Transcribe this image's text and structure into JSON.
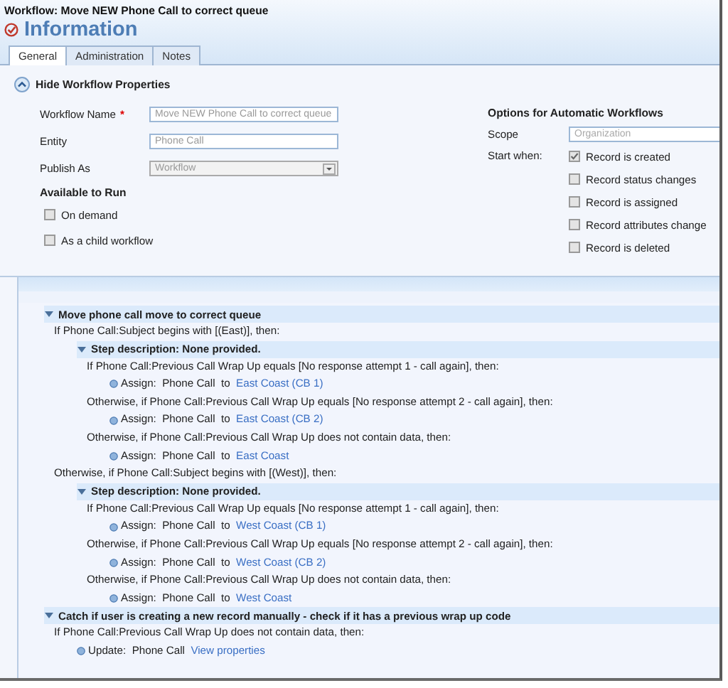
{
  "header": {
    "title": "Workflow: Move NEW Phone Call to correct queue",
    "heading": "Information"
  },
  "tabs": [
    {
      "label": "General",
      "selected": true
    },
    {
      "label": "Administration",
      "selected": false
    },
    {
      "label": "Notes",
      "selected": false
    }
  ],
  "properties": {
    "toggle": "Hide Workflow Properties",
    "expanded": true,
    "fields": [
      {
        "label": "Workflow Name",
        "required": "*",
        "value": "Move NEW Phone Call to correct queue",
        "kind": "text"
      },
      {
        "label": "Entity",
        "value": "Phone Call",
        "kind": "text"
      },
      {
        "label": "Publish As",
        "value": "Workflow",
        "kind": "select"
      }
    ],
    "available": {
      "heading": "Available to Run",
      "options": [
        {
          "label": "On demand",
          "checked": false
        },
        {
          "label": "As a child workflow",
          "checked": false
        }
      ]
    },
    "automatic": {
      "heading": "Options for Automatic Workflows",
      "scope_label": "Scope",
      "scope_value": "Organization",
      "start_label": "Start when:",
      "options": [
        {
          "label": "Record is created",
          "checked": true
        },
        {
          "label": "Record status changes",
          "checked": false
        },
        {
          "label": "Record is assigned",
          "checked": false
        },
        {
          "label": "Record attributes change",
          "checked": false
        },
        {
          "label": "Record is deleted",
          "checked": false
        }
      ]
    }
  },
  "steps": [
    {
      "kind": "stage",
      "label": "Move phone call move to correct queue",
      "expanded": true,
      "children": [
        {
          "kind": "condition",
          "text": "If Phone Call:Subject begins with [(East)], then:",
          "children": [
            {
              "kind": "stage",
              "label": "Step description: None provided.",
              "expanded": true,
              "children": [
                {
                  "kind": "condition",
                  "text": "If Phone Call:Previous Call Wrap Up equals [No response attempt 1 - call again], then:",
                  "children": [
                    {
                      "kind": "action",
                      "action": "Assign:",
                      "entity": "Phone Call",
                      "connector": "to",
                      "link": "East Coast (CB 1)"
                    }
                  ]
                },
                {
                  "kind": "condition",
                  "text": "Otherwise, if Phone Call:Previous Call Wrap Up equals [No response attempt 2 - call again], then:",
                  "children": [
                    {
                      "kind": "action",
                      "action": "Assign:",
                      "entity": "Phone Call",
                      "connector": "to",
                      "link": "East Coast (CB 2)"
                    }
                  ]
                },
                {
                  "kind": "condition",
                  "text": "Otherwise, if Phone Call:Previous Call Wrap Up does not contain data, then:",
                  "children": [
                    {
                      "kind": "action",
                      "action": "Assign:",
                      "entity": "Phone Call",
                      "connector": "to",
                      "link": "East Coast"
                    }
                  ]
                }
              ]
            }
          ]
        },
        {
          "kind": "condition",
          "text": "Otherwise, if Phone Call:Subject begins with [(West)], then:",
          "children": [
            {
              "kind": "stage",
              "label": "Step description: None provided.",
              "expanded": true,
              "children": [
                {
                  "kind": "condition",
                  "text": "If Phone Call:Previous Call Wrap Up equals [No response attempt 1 - call again], then:",
                  "children": [
                    {
                      "kind": "action",
                      "action": "Assign:",
                      "entity": "Phone Call",
                      "connector": "to",
                      "link": "West Coast (CB 1)"
                    }
                  ]
                },
                {
                  "kind": "condition",
                  "text": "Otherwise, if Phone Call:Previous Call Wrap Up equals [No response attempt 2 - call again], then:",
                  "children": [
                    {
                      "kind": "action",
                      "action": "Assign:",
                      "entity": "Phone Call",
                      "connector": "to",
                      "link": "West Coast (CB 2)"
                    }
                  ]
                },
                {
                  "kind": "condition",
                  "text": "Otherwise, if Phone Call:Previous Call Wrap Up does not contain data, then:",
                  "children": [
                    {
                      "kind": "action",
                      "action": "Assign:",
                      "entity": "Phone Call",
                      "connector": "to",
                      "link": "West Coast"
                    }
                  ]
                }
              ]
            }
          ]
        }
      ]
    },
    {
      "kind": "stage",
      "label": "Catch if user is creating a new record manually - check if it has a previous wrap up code",
      "expanded": true,
      "children": [
        {
          "kind": "condition",
          "text": "If Phone Call:Previous Call Wrap Up does not contain data, then:",
          "children": [
            {
              "kind": "action",
              "action": "Update:",
              "entity": "Phone Call",
              "link": "View properties"
            }
          ]
        }
      ]
    }
  ]
}
